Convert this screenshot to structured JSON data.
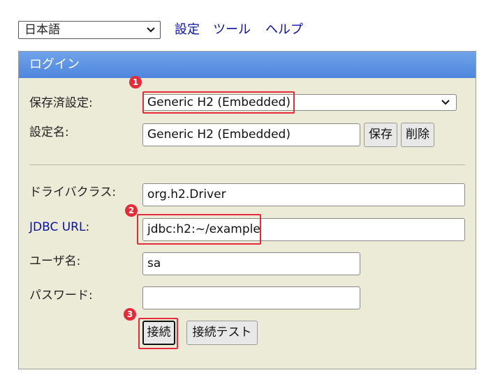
{
  "language": {
    "value": "日本語"
  },
  "nav": {
    "settings": "設定",
    "tools": "ツール",
    "help": "ヘルプ"
  },
  "panel": {
    "title": "ログイン",
    "saved_settings_label": "保存済設定:",
    "saved_settings_value": "Generic H2 (Embedded)",
    "setting_name_label": "設定名:",
    "setting_name_value": "Generic H2 (Embedded)",
    "save_button": "保存",
    "delete_button": "削除",
    "driver_class_label": "ドライバクラス:",
    "driver_class_value": "org.h2.Driver",
    "jdbc_url_label": "JDBC URL",
    "jdbc_url_colon": ":",
    "jdbc_url_value": "jdbc:h2:~/example",
    "username_label": "ユーザ名:",
    "username_value": "sa",
    "password_label": "パスワード:",
    "password_value": "",
    "connect_button": "接続",
    "test_connection_button": "接続テスト"
  },
  "annotations": {
    "step1": "1",
    "step2": "2",
    "step3": "3",
    "color": "#e52a3a"
  }
}
